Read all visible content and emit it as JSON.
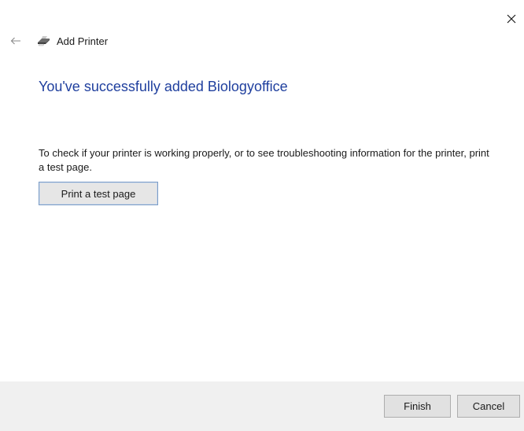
{
  "window": {
    "title": "Add Printer",
    "close_icon": "close-icon",
    "back_icon": "back-arrow-icon",
    "printer_icon": "printer-icon"
  },
  "main": {
    "heading": "You've successfully added Biologyoffice",
    "description": "To check if your printer is working properly, or to see troubleshooting information for the printer, print a test page.",
    "test_button_label": "Print a test page"
  },
  "footer": {
    "finish_label": "Finish",
    "cancel_label": "Cancel"
  },
  "colors": {
    "heading": "#1f3f9e",
    "footer_bg": "#f0f0f0",
    "focus_border": "#7a9cc6"
  }
}
